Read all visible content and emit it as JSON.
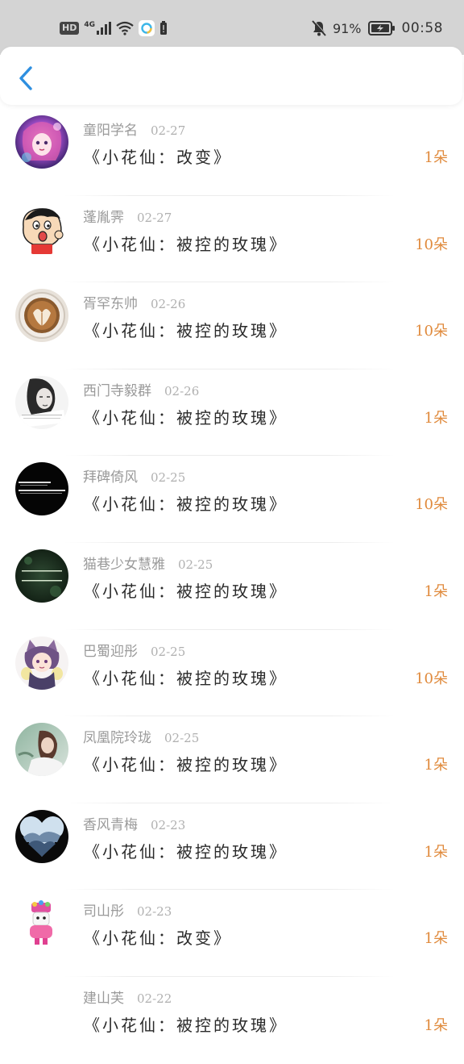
{
  "status_bar": {
    "hd": "HD",
    "network": "4G",
    "battery_pct": "91%",
    "time": "00:58"
  },
  "header": {
    "back_icon": "chevron-left-icon"
  },
  "colors": {
    "accent_blue": "#2e8fe0",
    "amount_orange": "#e08a3c"
  },
  "items": [
    {
      "name": "童阳学名",
      "date": "02-27",
      "title": "《小花仙：改变》",
      "amount": "1朵",
      "avatar": "anime-girl-pink"
    },
    {
      "name": "蓬胤霁",
      "date": "02-27",
      "title": "《小花仙：被控的玫瑰》",
      "amount": "10朵",
      "avatar": "cartoon-boy"
    },
    {
      "name": "胥罕东帅",
      "date": "02-26",
      "title": "《小花仙：被控的玫瑰》",
      "amount": "10朵",
      "avatar": "latte-art"
    },
    {
      "name": "西门寺毅群",
      "date": "02-26",
      "title": "《小花仙：被控的玫瑰》",
      "amount": "1朵",
      "avatar": "bw-girl"
    },
    {
      "name": "拜碑倚风",
      "date": "02-25",
      "title": "《小花仙：被控的玫瑰》",
      "amount": "10朵",
      "avatar": "black-text"
    },
    {
      "name": "猫巷少女慧雅",
      "date": "02-25",
      "title": "《小花仙：被控的玫瑰》",
      "amount": "1朵",
      "avatar": "green-text"
    },
    {
      "name": "巴蜀迎彤",
      "date": "02-25",
      "title": "《小花仙：被控的玫瑰》",
      "amount": "10朵",
      "avatar": "anime-cat"
    },
    {
      "name": "凤凰院玲珑",
      "date": "02-25",
      "title": "《小花仙：被控的玫瑰》",
      "amount": "1朵",
      "avatar": "girl-outdoor"
    },
    {
      "name": "香风青梅",
      "date": "02-23",
      "title": "《小花仙：被控的玫瑰》",
      "amount": "1朵",
      "avatar": "mountain-heart"
    },
    {
      "name": "司山彤",
      "date": "02-23",
      "title": "《小花仙：改变》",
      "amount": "1朵",
      "avatar": "toy-figure"
    },
    {
      "name": "建山芙",
      "date": "02-22",
      "title": "《小花仙：被控的玫瑰》",
      "amount": "1朵",
      "avatar": "none"
    }
  ]
}
